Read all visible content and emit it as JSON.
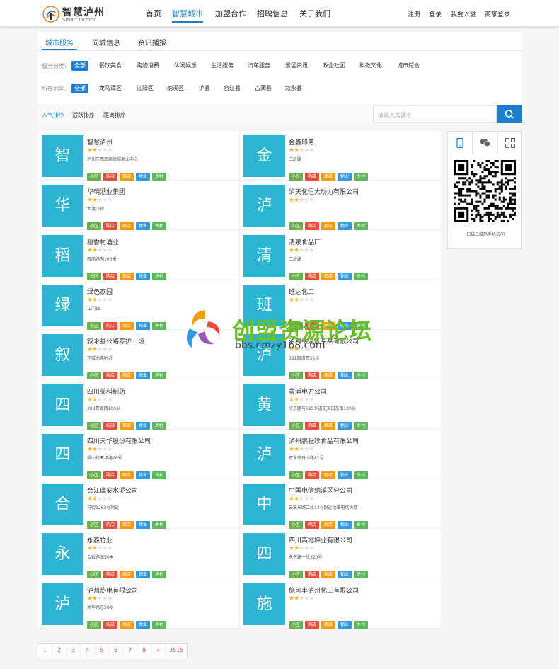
{
  "brand": {
    "name_cn": "智慧泸州",
    "name_en": "Smart Luzhou"
  },
  "nav": [
    "首页",
    "智慧城市",
    "加盟合作",
    "招聘信息",
    "关于我们"
  ],
  "top_links": [
    "注册",
    "登录",
    "我要入驻",
    "商家登录"
  ],
  "tabs": [
    "城市服务",
    "同城信息",
    "资讯播报"
  ],
  "filters": {
    "category_label": "服务分类:",
    "categories": [
      "全部",
      "餐饮美食",
      "购物消费",
      "休闲娱乐",
      "生活服务",
      "汽车服务",
      "景区资讯",
      "政企社团",
      "科教文化",
      "城市综合"
    ],
    "region_label": "所在地区:",
    "regions": [
      "全部",
      "龙马潭区",
      "江阳区",
      "纳溪区",
      "泸县",
      "合江县",
      "古蔺县",
      "叙永县"
    ]
  },
  "sort": [
    "人气排序",
    "活跃排序",
    "距离排序"
  ],
  "search": {
    "placeholder": "请输入关键字"
  },
  "tag_labels": [
    "小区",
    "购店",
    "商店",
    "物业",
    "乡村"
  ],
  "listings": [
    {
      "initial": "智",
      "name": "智慧泸州",
      "addr": "泸州市西南商贸城商业中心",
      "rating": 2
    },
    {
      "initial": "金",
      "name": "金鑫印务",
      "addr": "二级路",
      "rating": 2
    },
    {
      "initial": "华",
      "name": "华明酒业集团",
      "addr": "大渡口镇",
      "rating": 2
    },
    {
      "initial": "泸",
      "name": "泸天化恒大动力有限公司",
      "addr": "",
      "rating": 2
    },
    {
      "initial": "稻",
      "name": "稻香村酒业",
      "addr": "叙蔺路向100米",
      "rating": 2
    },
    {
      "initial": "清",
      "name": "清泉食品厂",
      "addr": "二级路",
      "rating": 2
    },
    {
      "initial": "绿",
      "name": "绿色家园",
      "addr": "江门镇",
      "rating": 2
    },
    {
      "initial": "班",
      "name": "班达化工",
      "addr": "",
      "rating": 2
    },
    {
      "initial": "叙",
      "name": "叙永县公路养护一段",
      "addr": "环城北路附近",
      "rating": 2
    },
    {
      "initial": "泸",
      "name": "泸州纳溪区某某有限公司",
      "addr": "321国道西50米",
      "rating": 2
    },
    {
      "initial": "四",
      "name": "四川美科制药",
      "addr": "308青源西100米",
      "rating": 2
    },
    {
      "initial": "黄",
      "name": "黄浦电力公司",
      "addr": "头子路与525乡道交叉口东南100米",
      "rating": 2
    },
    {
      "initial": "四",
      "name": "四川天华股份有限公司",
      "addr": "福山镇天华路26号",
      "rating": 2
    },
    {
      "initial": "泸",
      "name": "泸州鹏程珍食品有限公司",
      "addr": "叙永镇丹山路81号",
      "rating": 2
    },
    {
      "initial": "合",
      "name": "合江瑞安水泥公司",
      "addr": "马街1263号附近",
      "rating": 2
    },
    {
      "initial": "中",
      "name": "中国电信纳溪区分公司",
      "addr": "云溪东路二段13号附近纳溪电信大楼",
      "rating": 2
    },
    {
      "initial": "永",
      "name": "永鑫竹业",
      "addr": "合毅路南50米",
      "rating": 2
    },
    {
      "initial": "四",
      "name": "四川高地坤业有限公司",
      "addr": "永宁路一段320号",
      "rating": 2
    },
    {
      "initial": "泸",
      "name": "泸州热电有限公司",
      "addr": "关华路东50米",
      "rating": 2
    },
    {
      "initial": "施",
      "name": "施可丰泸州化工有限公司",
      "addr": "",
      "rating": 2
    }
  ],
  "qr": {
    "caption": "扫描二维码手机访问"
  },
  "pagination": [
    "1",
    "2",
    "3",
    "4",
    "5",
    "6",
    "7",
    "8",
    "»",
    "3515"
  ],
  "watermark": {
    "title": "创盟资源论坛",
    "url": "bbs.cmzy168.com"
  },
  "colors": {
    "accent": "#1a7fd0",
    "avatar": "#2bb5d2",
    "star": "#f3b62a"
  }
}
